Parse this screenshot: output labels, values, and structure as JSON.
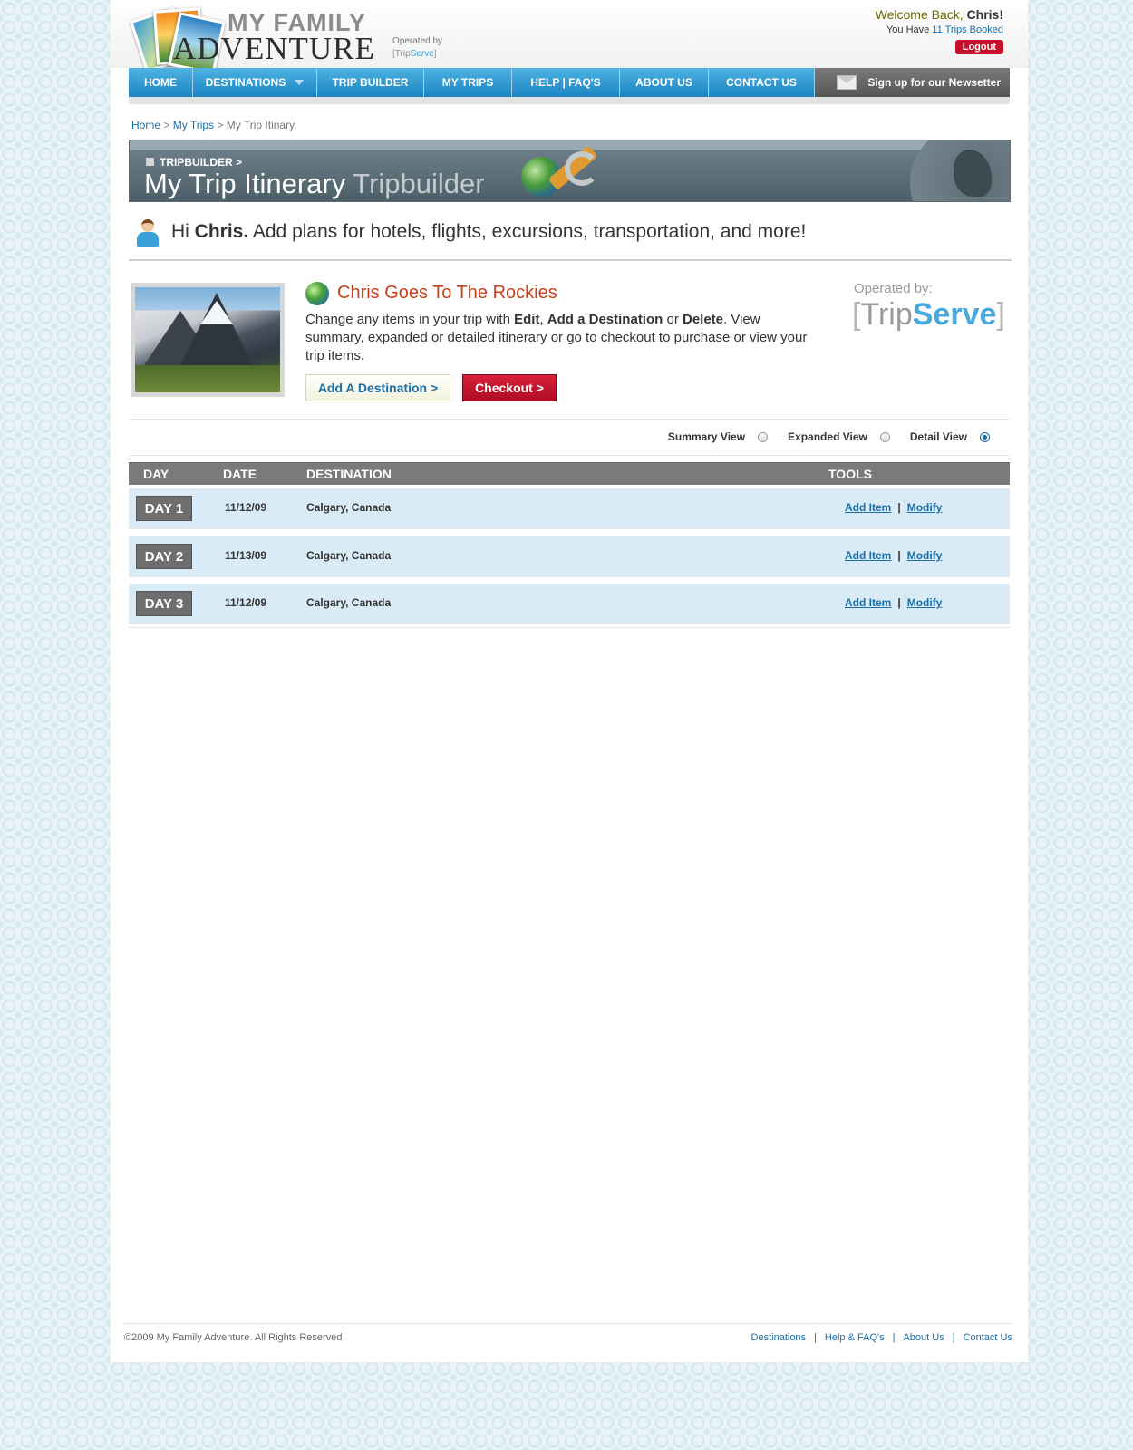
{
  "header": {
    "logo": {
      "line1": "MY FAMILY",
      "line2": "ADVENTURE",
      "operated_by": "Operated by",
      "bracket_open": "[",
      "brand_trip": "Trip",
      "brand_serve": "Serve",
      "bracket_close": "]"
    },
    "welcome_prefix": "Welcome Back, ",
    "user_name": "Chris!",
    "trips_prefix": "You Have ",
    "trips_link": "11 Trips Booked",
    "logout_label": "Logout"
  },
  "nav": {
    "items": [
      {
        "label": "HOME"
      },
      {
        "label": "DESTINATIONS"
      },
      {
        "label": "TRIP BUILDER"
      },
      {
        "label": "MY TRIPS"
      },
      {
        "label": "HELP | FAQ'S"
      },
      {
        "label": "ABOUT US"
      },
      {
        "label": "CONTACT US"
      }
    ],
    "newsletter": "Sign up for our Newsetter"
  },
  "breadcrumb": {
    "home": "Home",
    "sep1": " > ",
    "my_trips": "My Trips",
    "sep2": " > ",
    "current": "My Trip Itinary"
  },
  "banner": {
    "kicker": "TRIPBUILDER >",
    "title": "My Trip Itinerary",
    "subtitle": "Tripbuilder"
  },
  "greeting": {
    "hi": "Hi ",
    "name": "Chris.",
    "message": " Add plans for hotels, flights, excursions, transportation, and more!"
  },
  "trip": {
    "title": "Chris Goes To The Rockies",
    "desc_1": "Change any items in your trip with ",
    "desc_edit": "Edit",
    "desc_2": ", ",
    "desc_add": "Add a Destination",
    "desc_3": " or ",
    "desc_delete": "Delete",
    "desc_4": ". View summary, expanded or detailed itinerary or go to checkout to purchase or view your trip items.",
    "add_destination_label": "Add A Destination >",
    "checkout_label": "Checkout >"
  },
  "operator": {
    "label": "Operated by:",
    "bracket_open": "[",
    "brand_trip": "Trip",
    "brand_serve": "Serve",
    "bracket_close": "]"
  },
  "views": {
    "summary": "Summary View",
    "expanded": "Expanded View",
    "detail": "Detail View",
    "selected": "detail"
  },
  "table": {
    "headers": {
      "day": "DAY",
      "date": "DATE",
      "destination": "DESTINATION",
      "tools": "TOOLS"
    },
    "rows": [
      {
        "day": "DAY 1",
        "date": "11/12/09",
        "destination": "Calgary, Canada",
        "add": "Add Item",
        "sep": "|",
        "modify": "Modify"
      },
      {
        "day": "DAY 2",
        "date": "11/13/09",
        "destination": "Calgary, Canada",
        "add": "Add Item",
        "sep": "|",
        "modify": "Modify"
      },
      {
        "day": "DAY 3",
        "date": "11/12/09",
        "destination": "Calgary, Canada",
        "add": "Add Item",
        "sep": "|",
        "modify": "Modify"
      }
    ]
  },
  "footer": {
    "copyright": "©2009 My Family Adventure. All Rights Reserved",
    "links": [
      "Destinations",
      "Help & FAQ's",
      "About Us",
      "Contact Us"
    ],
    "sep": "|"
  },
  "colors": {
    "nav_blue": "#1a83c1",
    "link_blue": "#1a6fa8",
    "checkout_red": "#c4102b",
    "trip_title": "#c8401a",
    "row_bg": "#d9ebf7"
  }
}
